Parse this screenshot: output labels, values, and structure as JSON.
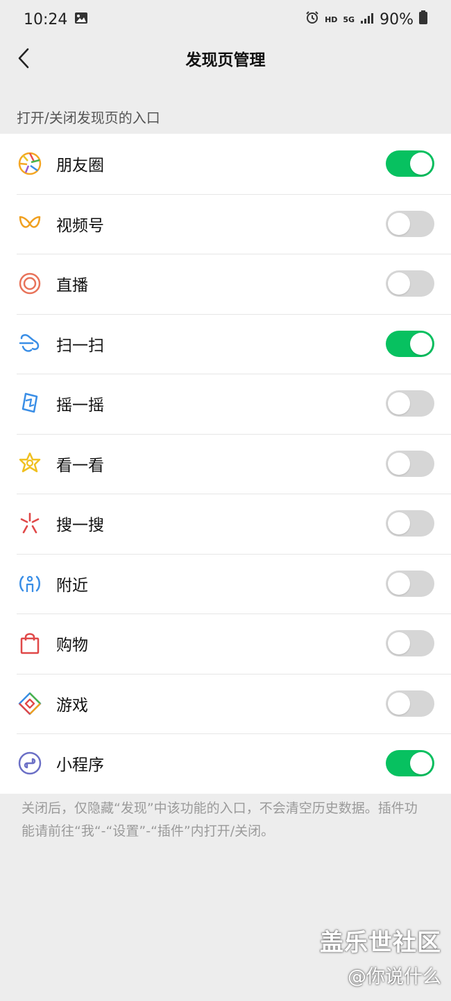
{
  "status_bar": {
    "time": "10:24",
    "hd": "HD",
    "network": "5G",
    "battery": "90%",
    "icons": [
      "gallery-icon",
      "alarm-icon",
      "signal-icon",
      "battery-icon"
    ]
  },
  "nav": {
    "title": "发现页管理",
    "back_icon": "chevron-left-icon"
  },
  "section": {
    "caption": "打开/关闭发现页的入口"
  },
  "items": [
    {
      "label": "朋友圈",
      "icon": "moments-icon",
      "enabled": true
    },
    {
      "label": "视频号",
      "icon": "channels-icon",
      "enabled": false
    },
    {
      "label": "直播",
      "icon": "live-icon",
      "enabled": false
    },
    {
      "label": "扫一扫",
      "icon": "scan-icon",
      "enabled": true
    },
    {
      "label": "摇一摇",
      "icon": "shake-icon",
      "enabled": false
    },
    {
      "label": "看一看",
      "icon": "top-stories-icon",
      "enabled": false
    },
    {
      "label": "搜一搜",
      "icon": "search-icon",
      "enabled": false
    },
    {
      "label": "附近",
      "icon": "nearby-icon",
      "enabled": false
    },
    {
      "label": "购物",
      "icon": "shopping-bag-icon",
      "enabled": false
    },
    {
      "label": "游戏",
      "icon": "games-icon",
      "enabled": false
    },
    {
      "label": "小程序",
      "icon": "mini-program-icon",
      "enabled": true
    }
  ],
  "footer": {
    "note": "关闭后，仅隐藏“发现”中该功能的入口，不会清空历史数据。插件功能请前往“我“-“设置”-“插件”内打开/关闭。"
  },
  "watermark": {
    "title": "盖乐世社区",
    "user": "@你说什么"
  },
  "colors": {
    "toggle_on": "#07c160",
    "toggle_off": "#d6d6d6",
    "background": "#ededed"
  }
}
